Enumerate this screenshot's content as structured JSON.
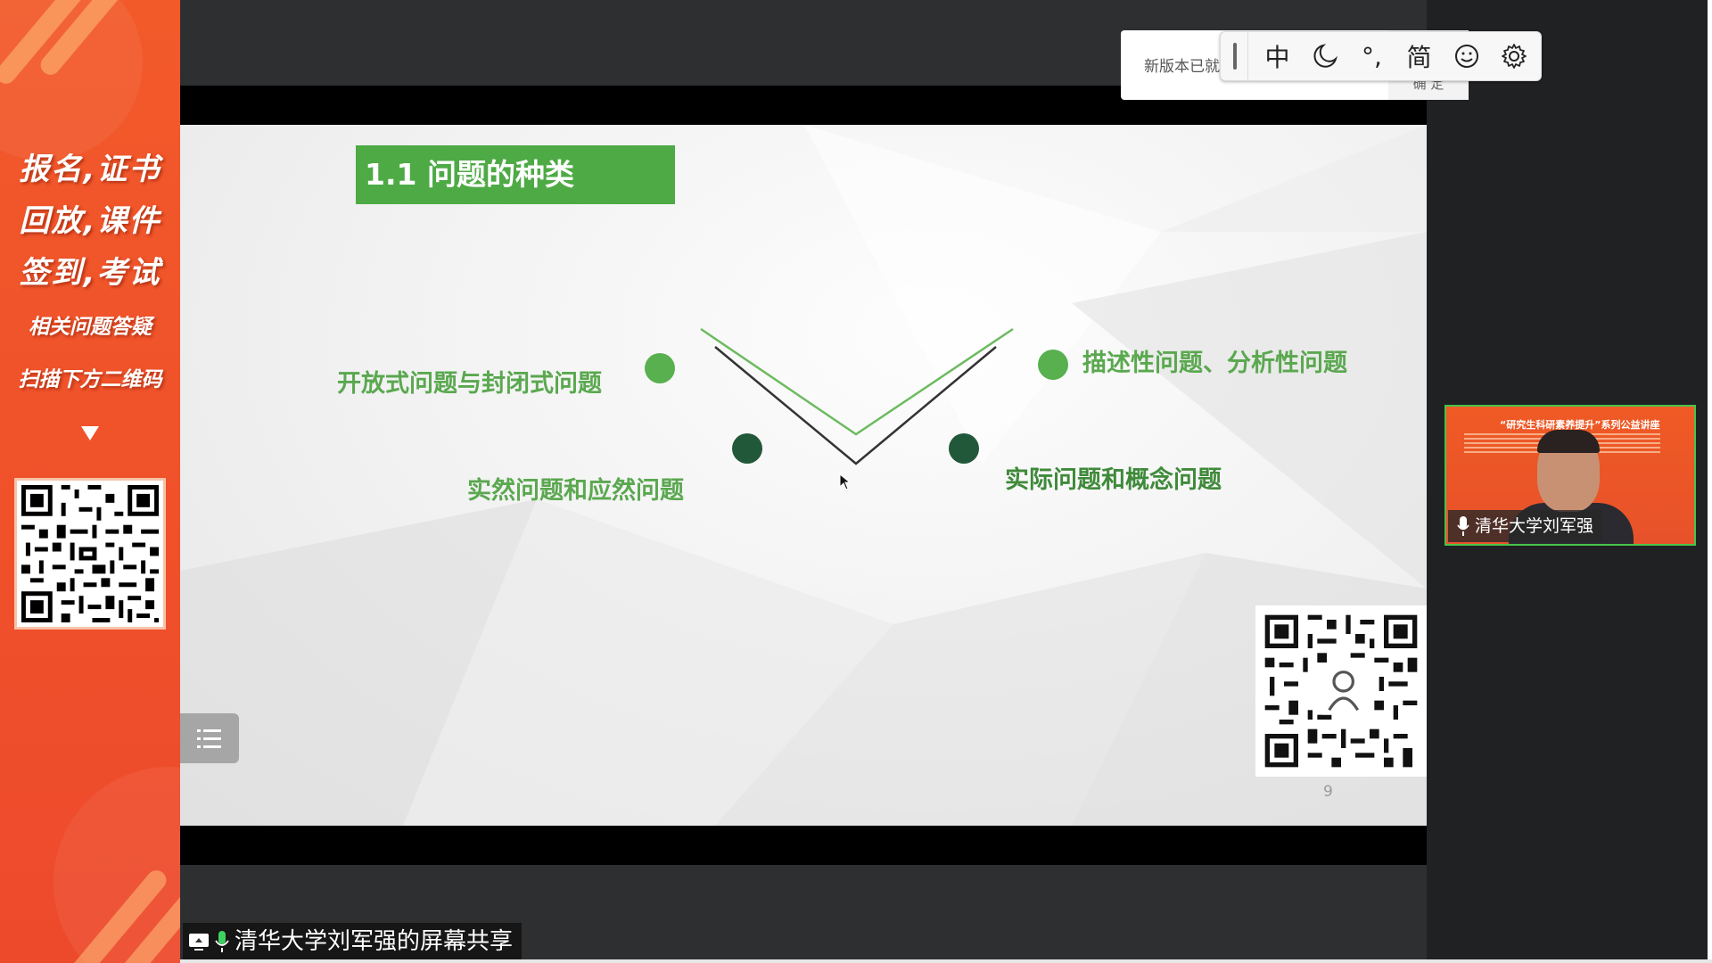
{
  "promo": {
    "lines_big": [
      "报名,证书",
      "回放,课件",
      "签到,考试"
    ],
    "lines_small": [
      "相关问题答疑",
      "扫描下方二维码"
    ],
    "accent": "#f0522a"
  },
  "slide": {
    "title": "1.1 问题的种类",
    "items": [
      "开放式问题与封闭式问题",
      "实然问题和应然问题",
      "描述性问题、分析性问题",
      "实际问题和概念问题"
    ],
    "page_number": "9",
    "accent": "#4eaa45"
  },
  "notice": {
    "text": "新版本已就",
    "confirm": "确 定"
  },
  "ime": {
    "buttons": [
      "中",
      "☽",
      "°,",
      "简",
      "☺",
      "⚙"
    ],
    "icons": [
      "chinese-mode-icon",
      "moon-icon",
      "punctuation-icon",
      "simplified-icon",
      "emoji-icon",
      "gear-icon"
    ]
  },
  "video": {
    "header": "“研究生科研素养提升”系列公益讲座",
    "speaker": "清华大学刘军强"
  },
  "share": {
    "label": "清华大学刘军强的屏幕共享"
  }
}
